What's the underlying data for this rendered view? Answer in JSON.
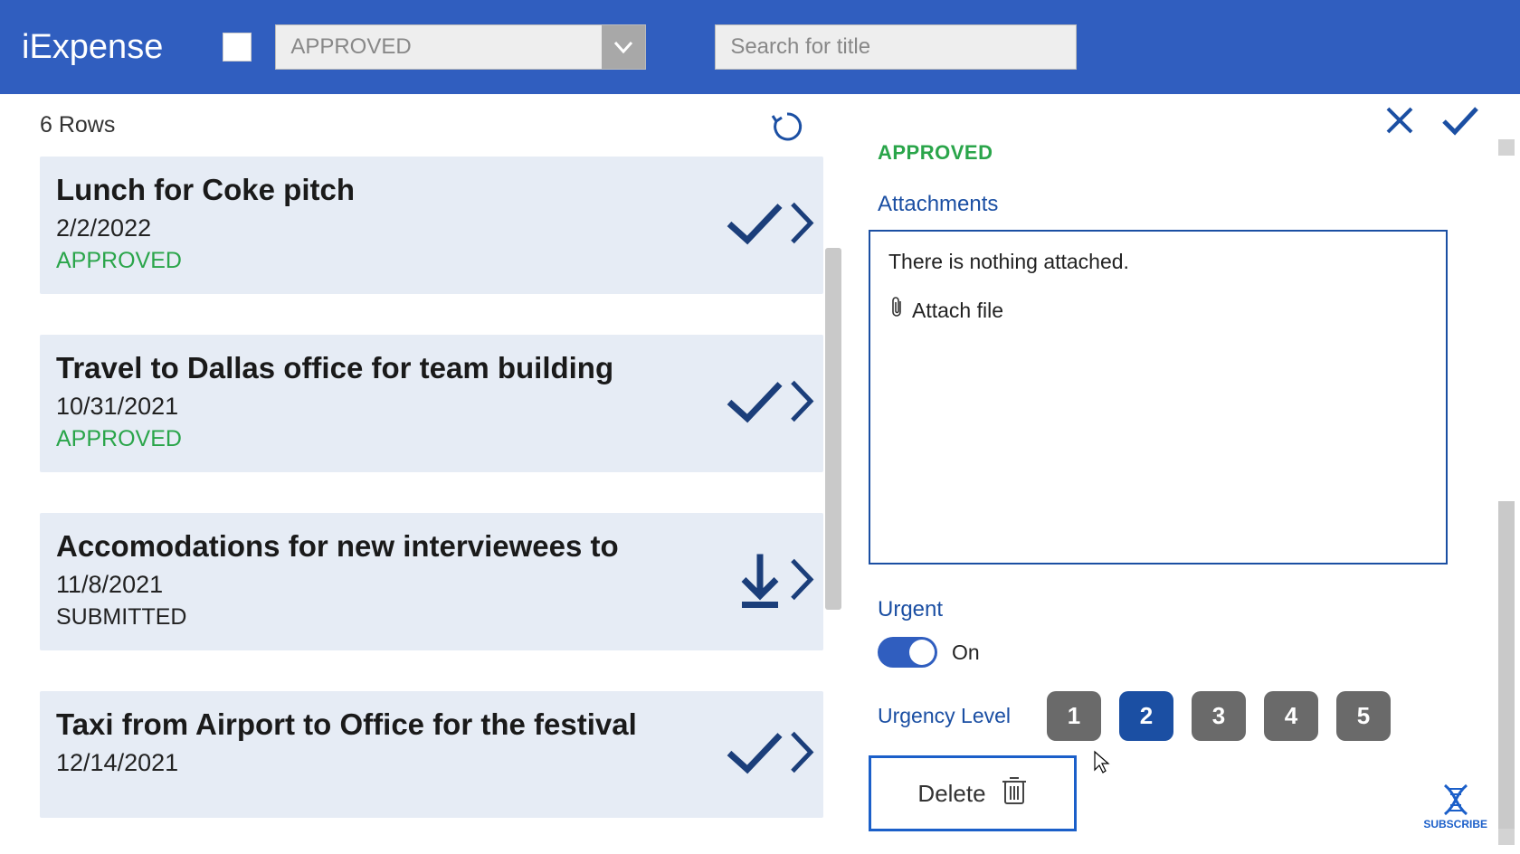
{
  "header": {
    "app_title": "iExpense",
    "filter_value": "APPROVED",
    "search_placeholder": "Search for title"
  },
  "list": {
    "row_count_label": "6 Rows",
    "items": [
      {
        "title": "Lunch for Coke pitch",
        "date": "2/2/2022",
        "status": "APPROVED",
        "status_kind": "approved",
        "action": "check"
      },
      {
        "title": "Travel to Dallas office for team building",
        "date": "10/31/2021",
        "status": "APPROVED",
        "status_kind": "approved",
        "action": "check"
      },
      {
        "title": "Accomodations for new interviewees to",
        "date": "11/8/2021",
        "status": "SUBMITTED",
        "status_kind": "submitted",
        "action": "download"
      },
      {
        "title": "Taxi from Airport to Office for the festival",
        "date": "12/14/2021",
        "status": "",
        "status_kind": "",
        "action": "check"
      }
    ]
  },
  "detail": {
    "status": "APPROVED",
    "attachments_label": "Attachments",
    "attachments_empty": "There is nothing attached.",
    "attach_file_label": "Attach file",
    "urgent_label": "Urgent",
    "urgent_value_label": "On",
    "urgency_level_label": "Urgency Level",
    "urgency_options": [
      "1",
      "2",
      "3",
      "4",
      "5"
    ],
    "urgency_selected": "2",
    "delete_label": "Delete",
    "subscribe_label": "SUBSCRIBE"
  },
  "colors": {
    "brand": "#305ebf",
    "section": "#1b4fa3",
    "approved": "#2aa54a"
  }
}
